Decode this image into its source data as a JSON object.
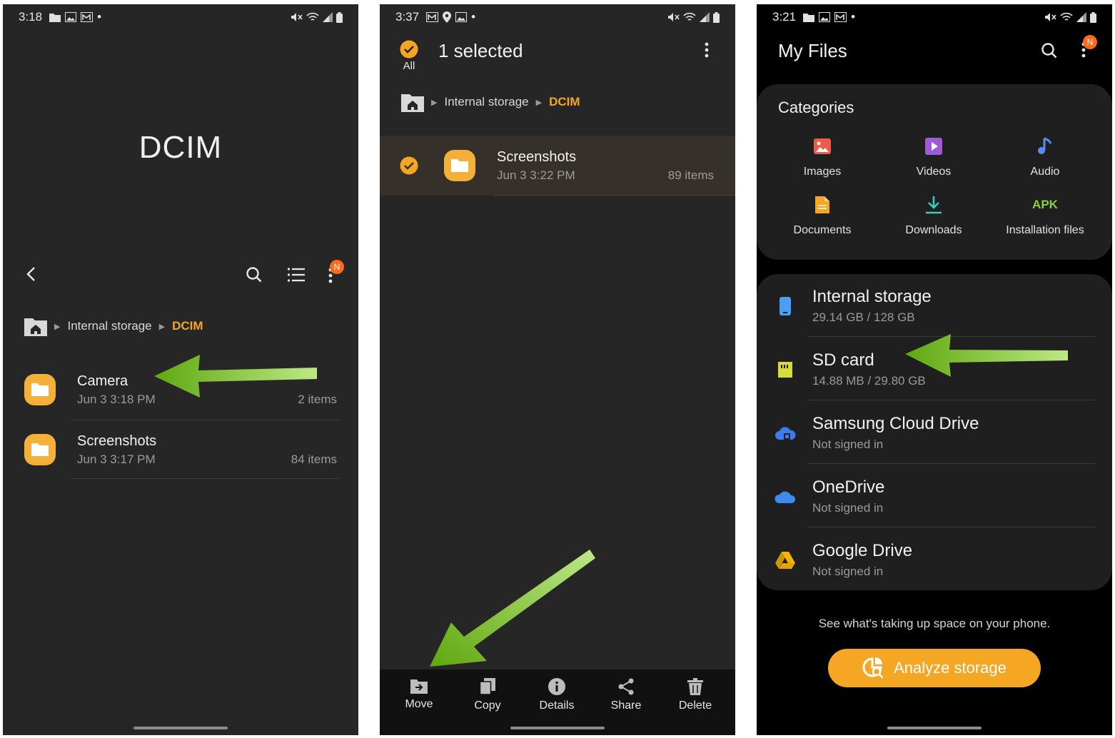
{
  "screen1": {
    "status_time": "3:18",
    "title": "DCIM",
    "badge": "N",
    "breadcrumb": {
      "parent": "Internal storage",
      "current": "DCIM"
    },
    "folders": [
      {
        "name": "Camera",
        "date": "Jun 3 3:18 PM",
        "count": "2 items"
      },
      {
        "name": "Screenshots",
        "date": "Jun 3 3:17 PM",
        "count": "84 items"
      }
    ]
  },
  "screen2": {
    "status_time": "3:37",
    "selection_title": "1 selected",
    "all_label": "All",
    "breadcrumb": {
      "parent": "Internal storage",
      "current": "DCIM"
    },
    "folder": {
      "name": "Screenshots",
      "date": "Jun 3 3:22 PM",
      "count": "89 items"
    },
    "actions": [
      "Move",
      "Copy",
      "Details",
      "Share",
      "Delete"
    ]
  },
  "screen3": {
    "status_time": "3:21",
    "title": "My Files",
    "badge": "N",
    "categories_title": "Categories",
    "categories": [
      "Images",
      "Videos",
      "Audio",
      "Documents",
      "Downloads",
      "Installation files"
    ],
    "apk_label": "APK",
    "storage": [
      {
        "name": "Internal storage",
        "sub": "29.14 GB / 128 GB"
      },
      {
        "name": "SD card",
        "sub": "14.88 MB / 29.80 GB"
      },
      {
        "name": "Samsung Cloud Drive",
        "sub": "Not signed in"
      },
      {
        "name": "OneDrive",
        "sub": "Not signed in"
      },
      {
        "name": "Google Drive",
        "sub": "Not signed in"
      }
    ],
    "tip": "See what's taking up space on your phone.",
    "analyze_label": "Analyze storage"
  },
  "colors": {
    "accent": "#f5a623",
    "arrow": "#7dc31f",
    "badge": "#ff6a1a",
    "background": "#262626"
  }
}
